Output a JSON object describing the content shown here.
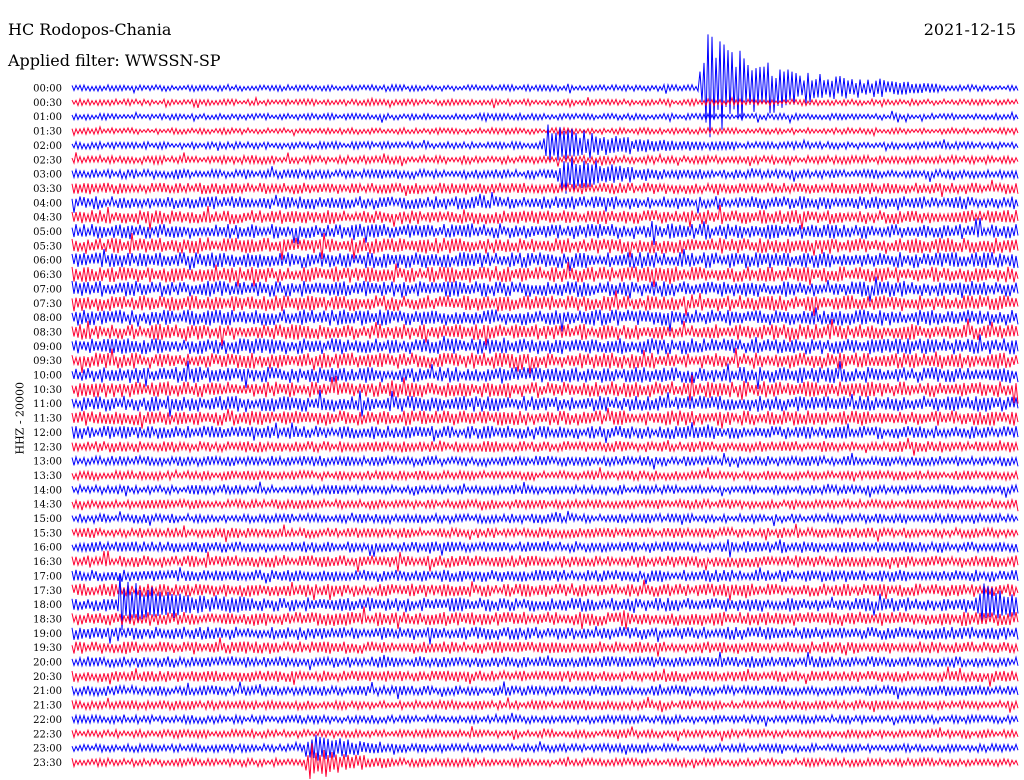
{
  "station": "HC Rodopos-Chania",
  "date": "2021-12-15",
  "filter": "Applied filter: WWSSN-SP",
  "channel": "HHZ - 20000",
  "colors": {
    "even": "#0000ff",
    "odd": "#ff0033",
    "background": "#ffffff"
  },
  "chart_data": {
    "type": "line",
    "description_kind": "helicorder",
    "row_labels": [
      "00:00",
      "00:30",
      "01:00",
      "01:30",
      "02:00",
      "02:30",
      "03:00",
      "03:30",
      "04:00",
      "04:30",
      "05:00",
      "05:30",
      "06:00",
      "06:30",
      "07:00",
      "07:30",
      "08:00",
      "08:30",
      "09:00",
      "09:30",
      "10:00",
      "10:30",
      "11:00",
      "11:30",
      "12:00",
      "12:30",
      "13:00",
      "13:30",
      "14:00",
      "14:30",
      "15:00",
      "15:30",
      "16:00",
      "16:30",
      "17:00",
      "17:30",
      "18:00",
      "18:30",
      "19:00",
      "19:30",
      "20:00",
      "20:30",
      "21:00",
      "21:30",
      "22:00",
      "22:30",
      "23:00",
      "23:30"
    ],
    "row_noise_level": [
      0.35,
      0.35,
      0.35,
      0.35,
      0.4,
      0.45,
      0.5,
      0.6,
      0.7,
      0.75,
      0.8,
      0.85,
      0.85,
      0.85,
      0.85,
      0.85,
      0.85,
      0.85,
      0.85,
      0.85,
      0.85,
      0.85,
      0.85,
      0.8,
      0.7,
      0.6,
      0.55,
      0.5,
      0.5,
      0.5,
      0.5,
      0.55,
      0.6,
      0.65,
      0.65,
      0.7,
      0.75,
      0.75,
      0.7,
      0.65,
      0.6,
      0.6,
      0.55,
      0.5,
      0.45,
      0.45,
      0.45,
      0.45
    ],
    "events": [
      {
        "row": 0,
        "minute": 20.0,
        "amplitude": 6.0,
        "duration_min": 2.5
      },
      {
        "row": 4,
        "minute": 15.0,
        "amplitude": 2.2,
        "duration_min": 2.0
      },
      {
        "row": 6,
        "minute": 15.5,
        "amplitude": 2.0,
        "duration_min": 1.5
      },
      {
        "row": 36,
        "minute": 1.5,
        "amplitude": 2.6,
        "duration_min": 1.5
      },
      {
        "row": 36,
        "minute": 28.8,
        "amplitude": 2.0,
        "duration_min": 1.0
      },
      {
        "row": 46,
        "minute": 7.5,
        "amplitude": 1.8,
        "duration_min": 1.0
      },
      {
        "row": 47,
        "minute": 7.5,
        "amplitude": 2.0,
        "duration_min": 1.0
      }
    ]
  }
}
